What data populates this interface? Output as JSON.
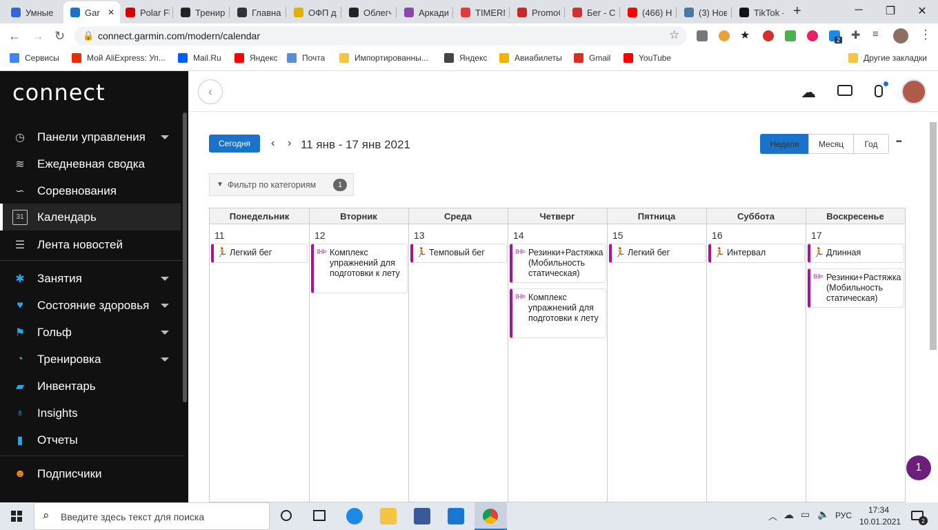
{
  "browser": {
    "tabs": [
      {
        "title": "Умные",
        "color": "#3367d6"
      },
      {
        "title": "Gar",
        "color": "#1a73c8",
        "active": true
      },
      {
        "title": "Polar Fl",
        "color": "#d50000"
      },
      {
        "title": "Трениро",
        "color": "#222222"
      },
      {
        "title": "Главна",
        "color": "#333333"
      },
      {
        "title": "ОФП дл",
        "color": "#e0b000"
      },
      {
        "title": "Облегч",
        "color": "#222222"
      },
      {
        "title": "Аркади",
        "color": "#8e44ad"
      },
      {
        "title": "TIMERM",
        "color": "#e53935"
      },
      {
        "title": "PromoC",
        "color": "#c62828"
      },
      {
        "title": "Бег - Ст",
        "color": "#d32f2f"
      },
      {
        "title": "(466) Н",
        "color": "#ff0000"
      },
      {
        "title": "(3) Нов",
        "color": "#4a76a8"
      },
      {
        "title": "TikTok -",
        "color": "#111111"
      }
    ],
    "new_tab_symbol": "+",
    "url": "connect.garmin.com/modern/calendar",
    "profile_badge": "2",
    "bookmarks": [
      {
        "label": "Сервисы",
        "color": "#4285f4"
      },
      {
        "label": "Мой AliExpress: Уп...",
        "color": "#e62e04"
      },
      {
        "label": "Mail.Ru",
        "color": "#005ff9"
      },
      {
        "label": "Яндекс",
        "color": "#ff0000"
      },
      {
        "label": "Почта",
        "color": "#5b8dd6"
      },
      {
        "label": "Импортированны...",
        "color": "#f6c443"
      },
      {
        "label": "Яндекс",
        "color": "#444444"
      },
      {
        "label": "Авиабилеты",
        "color": "#f0b400"
      },
      {
        "label": "Gmail",
        "color": "#d93025"
      },
      {
        "label": "YouTube",
        "color": "#ff0000"
      }
    ],
    "other_bookmarks": "Другие закладки"
  },
  "app": {
    "logo": "connect",
    "nav": [
      {
        "label": "Панели управления",
        "icon": "gauge-icon",
        "glyph": "◷",
        "chevron": true
      },
      {
        "label": "Ежедневная сводка",
        "icon": "layers-icon",
        "glyph": "≋",
        "chevron": false
      },
      {
        "label": "Соревнования",
        "icon": "trend-icon",
        "glyph": "∽",
        "chevron": false
      },
      {
        "label": "Календарь",
        "icon": "calendar-icon",
        "glyph": "31",
        "chevron": false,
        "active": true
      },
      {
        "label": "Лента новостей",
        "icon": "newsfeed-icon",
        "glyph": "☰",
        "chevron": false
      },
      {
        "label": "Занятия",
        "icon": "activity-icon",
        "glyph": "✱",
        "chevron": true
      },
      {
        "label": "Состояние здоровья",
        "icon": "heart-icon",
        "glyph": "♥",
        "chevron": true
      },
      {
        "label": "Гольф",
        "icon": "golf-icon",
        "glyph": "⚑",
        "chevron": true
      },
      {
        "label": "Тренировка",
        "icon": "stopwatch-icon",
        "glyph": "◔",
        "chevron": true
      },
      {
        "label": "Инвентарь",
        "icon": "shoe-icon",
        "glyph": "▰",
        "chevron": false
      },
      {
        "label": "Insights",
        "icon": "lightbulb-icon",
        "glyph": "♁",
        "chevron": false
      },
      {
        "label": "Отчеты",
        "icon": "bar-chart-icon",
        "glyph": "▮",
        "chevron": false
      },
      {
        "label": "Подписчики",
        "icon": "people-icon",
        "glyph": "☻",
        "chevron": false
      }
    ]
  },
  "calendar": {
    "today_label": "Сегодня",
    "range": "11 янв - 17 янв 2021",
    "filter_label": "Фильтр по категориям",
    "filter_count": "1",
    "views": [
      "Неделя",
      "Месяц",
      "Год"
    ],
    "active_view": "Неделя",
    "more": "•••",
    "days": [
      {
        "name": "Понедельник",
        "num": "11",
        "events": [
          {
            "title": "Легкий бег",
            "kind": "run"
          }
        ]
      },
      {
        "name": "Вторник",
        "num": "12",
        "events": [
          {
            "title": "Комплекс упражнений для подготовки к лету",
            "kind": "strength"
          }
        ]
      },
      {
        "name": "Среда",
        "num": "13",
        "events": [
          {
            "title": "Темповый бег",
            "kind": "run"
          }
        ]
      },
      {
        "name": "Четверг",
        "num": "14",
        "events": [
          {
            "title": "Резинки+Растяжка (Мобильность статическая)",
            "kind": "strength"
          },
          {
            "title": "Комплекс упражнений для подготовки к лету",
            "kind": "strength"
          }
        ]
      },
      {
        "name": "Пятница",
        "num": "15",
        "events": [
          {
            "title": "Легкий бег",
            "kind": "run"
          }
        ]
      },
      {
        "name": "Суббота",
        "num": "16",
        "events": [
          {
            "title": "Интервал",
            "kind": "run"
          }
        ]
      },
      {
        "name": "Воскресенье",
        "num": "17",
        "events": [
          {
            "title": "Длинная",
            "kind": "run"
          },
          {
            "title": "Резинки+Растяжка (Мобильность статическая)",
            "kind": "strength"
          }
        ]
      }
    ],
    "chat_badge": "1",
    "accent": "#1a73c8",
    "event_color": "#a8129a"
  },
  "taskbar": {
    "search_placeholder": "Введите здесь текст для поиска",
    "lang": "РУС",
    "time": "17:34",
    "date": "10.01.2021",
    "notif_count": "2"
  }
}
